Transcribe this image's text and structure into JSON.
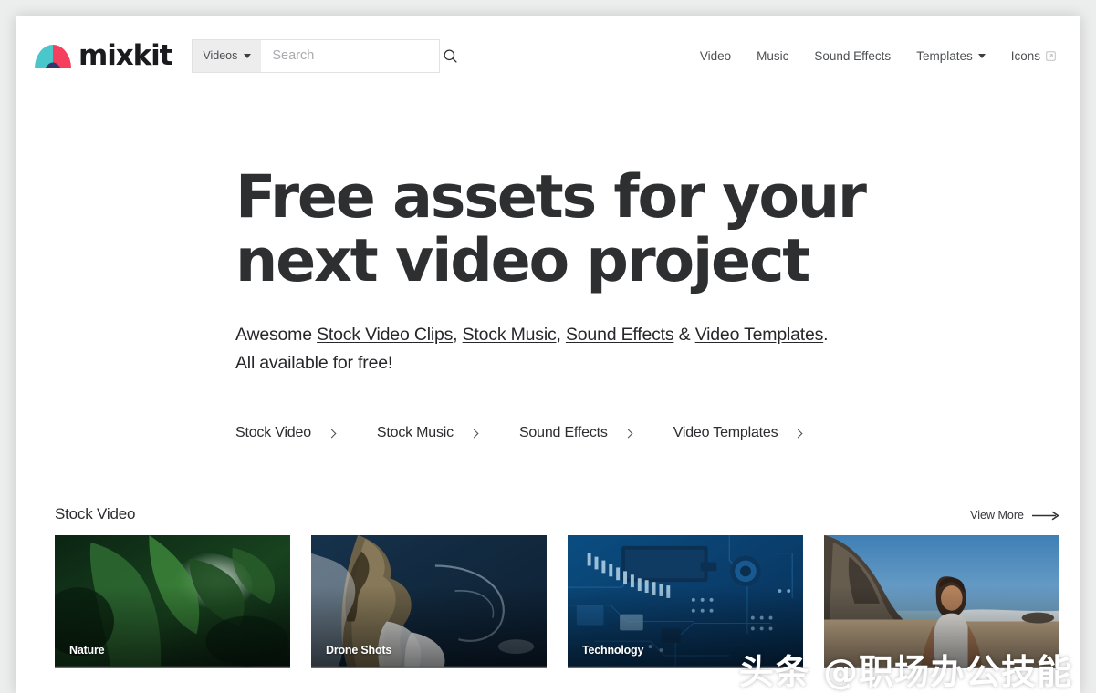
{
  "brand": {
    "wordmark": "mixkit",
    "logo_icon": "mixkit-arc-logo",
    "colors": {
      "teal": "#4ac7cb",
      "pink": "#f43f5e",
      "navy": "#33366b"
    }
  },
  "search": {
    "scope_label": "Videos",
    "scope_caret_icon": "chevron-down-icon",
    "placeholder": "Search",
    "value": "",
    "submit_icon": "search-icon"
  },
  "nav": {
    "items": [
      {
        "label": "Video",
        "icon": null
      },
      {
        "label": "Music",
        "icon": null
      },
      {
        "label": "Sound Effects",
        "icon": null
      },
      {
        "label": "Templates",
        "icon": "chevron-down-icon"
      },
      {
        "label": "Icons",
        "icon": "external-link-icon"
      }
    ]
  },
  "hero": {
    "title_line1": "Free assets for your",
    "title_line2": "next video project",
    "sub_prefix": "Awesome ",
    "sub_links": [
      {
        "label": "Stock Video Clips",
        "after": ", "
      },
      {
        "label": "Stock Music",
        "after": ", "
      },
      {
        "label": "Sound Effects",
        "after": " & "
      },
      {
        "label": "Video Templates",
        "after": "."
      }
    ],
    "sub_line2": "All available for free!",
    "cta_links": [
      {
        "label": "Stock Video",
        "icon": "chevron-right-icon"
      },
      {
        "label": "Stock Music",
        "icon": "chevron-right-icon"
      },
      {
        "label": "Sound Effects",
        "icon": "chevron-right-icon"
      },
      {
        "label": "Video Templates",
        "icon": "chevron-right-icon"
      }
    ]
  },
  "section": {
    "title": "Stock Video",
    "view_more_label": "View More",
    "view_more_icon": "long-arrow-right-icon",
    "cards": [
      {
        "label": "Nature",
        "art": "green-leaves"
      },
      {
        "label": "Drone Shots",
        "art": "aerial-coastline"
      },
      {
        "label": "Technology",
        "art": "circuit-board"
      },
      {
        "label": "",
        "art": "beach-woman"
      }
    ]
  },
  "watermark": {
    "text": "头条 @职场办公技能"
  }
}
